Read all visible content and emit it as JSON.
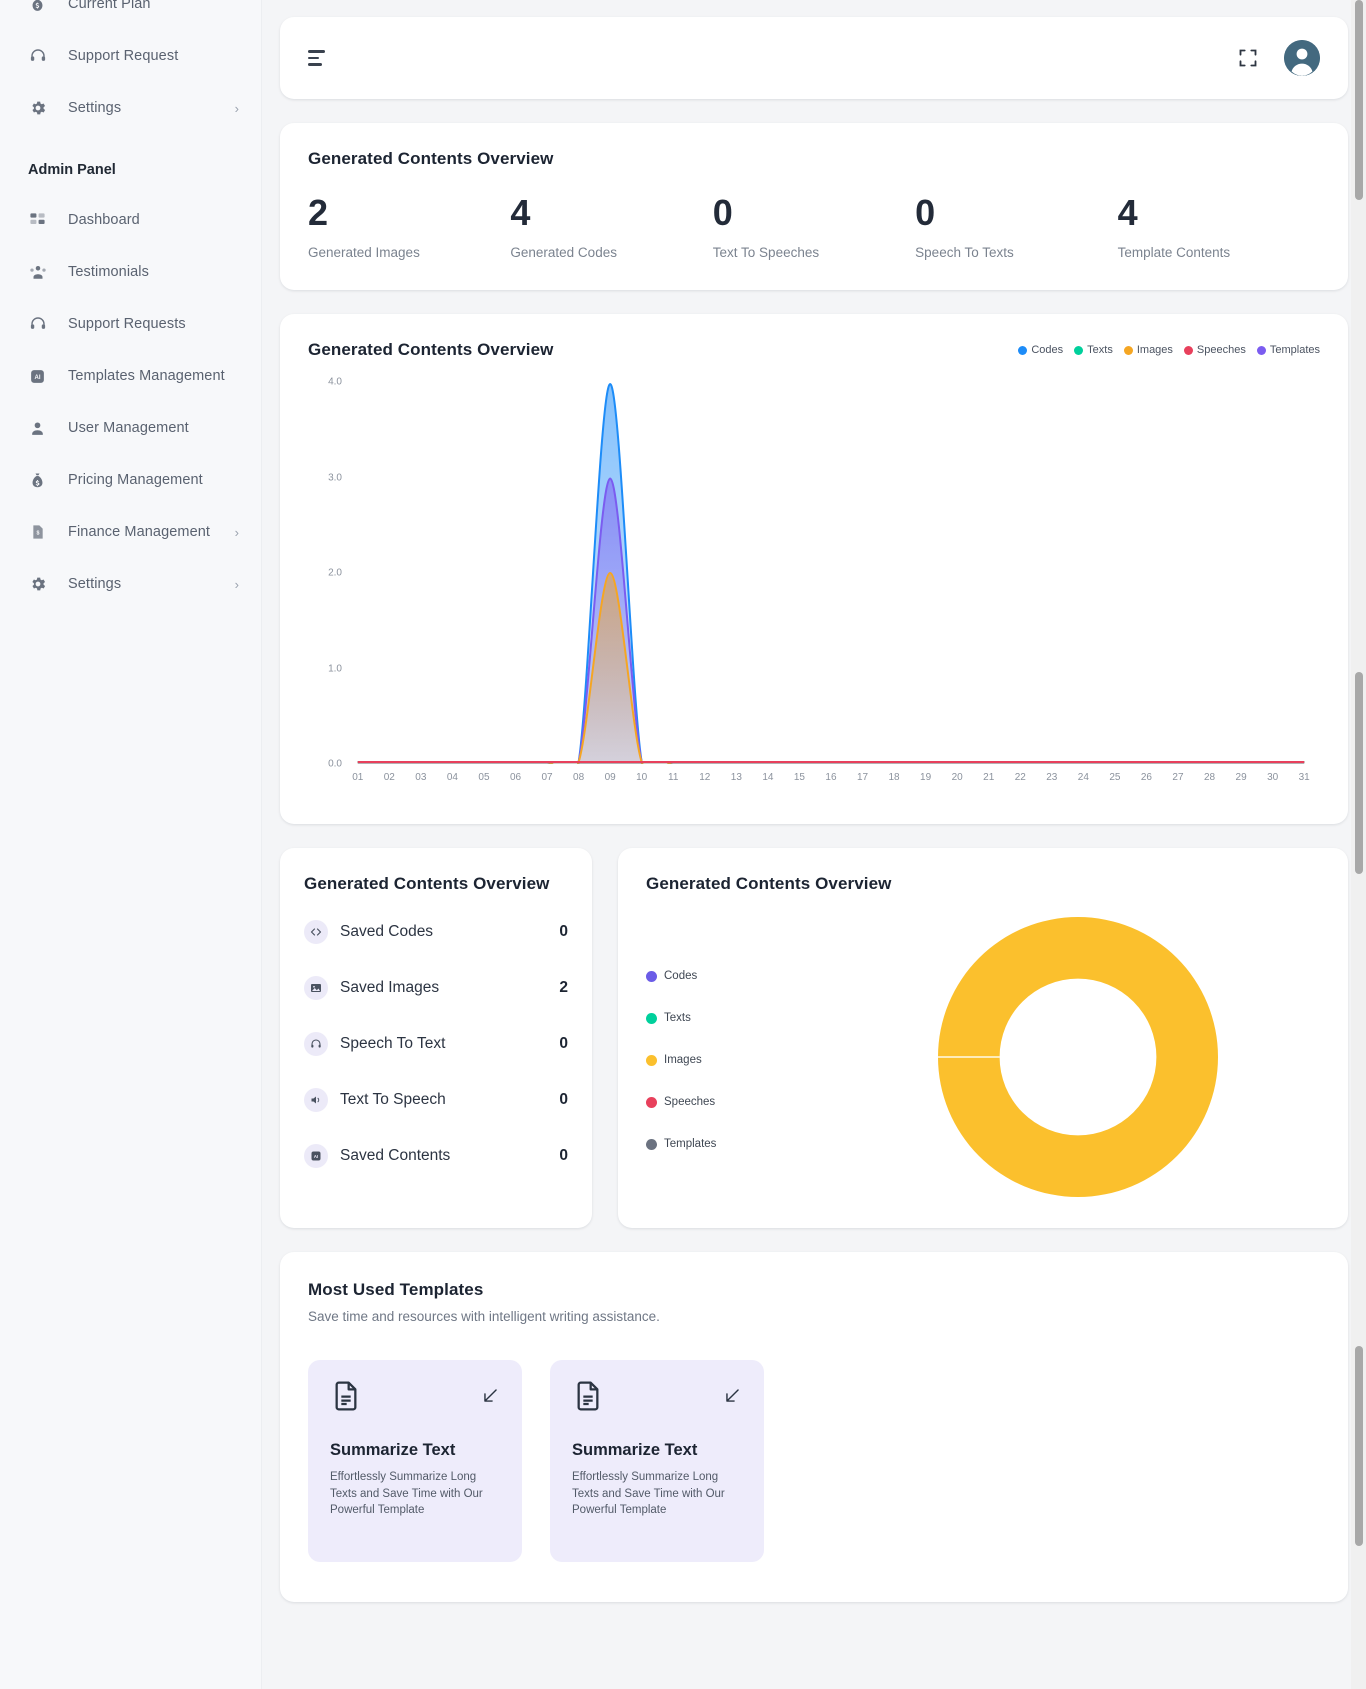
{
  "sidebar": {
    "top_items": [
      {
        "label": "Current Plan",
        "icon": "wallet-icon",
        "chevron": false
      },
      {
        "label": "Support Request",
        "icon": "headset-icon",
        "chevron": false
      },
      {
        "label": "Settings",
        "icon": "gear-icon",
        "chevron": true
      }
    ],
    "section_label": "Admin Panel",
    "admin_items": [
      {
        "label": "Dashboard",
        "icon": "grid-icon",
        "chevron": false
      },
      {
        "label": "Testimonials",
        "icon": "people-icon",
        "chevron": false
      },
      {
        "label": "Support Requests",
        "icon": "headset-icon",
        "chevron": false
      },
      {
        "label": "Templates Management",
        "icon": "ai-chip-icon",
        "chevron": false
      },
      {
        "label": "User Management",
        "icon": "user-icon",
        "chevron": false
      },
      {
        "label": "Pricing Management",
        "icon": "money-bag-icon",
        "chevron": false
      },
      {
        "label": "Finance Management",
        "icon": "invoice-icon",
        "chevron": true
      },
      {
        "label": "Settings",
        "icon": "gear-icon",
        "chevron": true
      }
    ],
    "chevron_glyph": "›"
  },
  "topbar": {
    "menu_icon": "hamburger-icon",
    "fullscreen_icon": "fullscreen-icon",
    "avatar_icon": "user-avatar"
  },
  "stats": {
    "title": "Generated Contents Overview",
    "items": [
      {
        "value": "2",
        "label": "Generated Images"
      },
      {
        "value": "4",
        "label": "Generated Codes"
      },
      {
        "value": "0",
        "label": "Text To Speeches"
      },
      {
        "value": "0",
        "label": "Speech To Texts"
      },
      {
        "value": "4",
        "label": "Template Contents"
      }
    ]
  },
  "line_card": {
    "title": "Generated Contents Overview"
  },
  "list_card": {
    "title": "Generated Contents Overview",
    "rows": [
      {
        "label": "Saved Codes",
        "value": "0",
        "icon": "code-icon"
      },
      {
        "label": "Saved Images",
        "value": "2",
        "icon": "image-icon"
      },
      {
        "label": "Speech To Text",
        "value": "0",
        "icon": "headphones-icon"
      },
      {
        "label": "Text To Speech",
        "value": "0",
        "icon": "speaker-icon"
      },
      {
        "label": "Saved Contents",
        "value": "0",
        "icon": "ai-chip-icon"
      }
    ]
  },
  "donut_card": {
    "title": "Generated Contents Overview"
  },
  "templates": {
    "title": "Most Used Templates",
    "subtitle": "Save time and resources with intelligent writing assistance.",
    "items": [
      {
        "name": "Summarize Text",
        "desc": "Effortlessly Summarize Long Texts and Save Time with Our Powerful Template",
        "icon": "document-icon",
        "action_icon": "arrow-down-left-icon"
      },
      {
        "name": "Summarize Text",
        "desc": "Effortlessly Summarize Long Texts and Save Time with Our Powerful Template",
        "icon": "document-icon",
        "action_icon": "arrow-down-left-icon"
      }
    ]
  },
  "chart_data": [
    {
      "id": "generated-contents-line",
      "type": "area",
      "title": "Generated Contents Overview",
      "xlabel": "",
      "ylabel": "",
      "grid": false,
      "legend_position": "top-right",
      "x": [
        "01",
        "02",
        "03",
        "04",
        "05",
        "06",
        "07",
        "08",
        "09",
        "10",
        "11",
        "12",
        "13",
        "14",
        "15",
        "16",
        "17",
        "18",
        "19",
        "20",
        "21",
        "22",
        "23",
        "24",
        "25",
        "26",
        "27",
        "28",
        "29",
        "30",
        "31"
      ],
      "ylim": [
        0,
        4
      ],
      "yticks": [
        "0.0",
        "1.0",
        "2.0",
        "3.0",
        "4.0"
      ],
      "series": [
        {
          "name": "Codes",
          "color": "#1d8cf8",
          "values": [
            0,
            0,
            0,
            0,
            0,
            0,
            0,
            0,
            4,
            0,
            0,
            0,
            0,
            0,
            0,
            0,
            0,
            0,
            0,
            0,
            0,
            0,
            0,
            0,
            0,
            0,
            0,
            0,
            0,
            0,
            0
          ]
        },
        {
          "name": "Texts",
          "color": "#00d09c",
          "values": [
            0,
            0,
            0,
            0,
            0,
            0,
            0,
            0,
            0,
            0,
            0,
            0,
            0,
            0,
            0,
            0,
            0,
            0,
            0,
            0,
            0,
            0,
            0,
            0,
            0,
            0,
            0,
            0,
            0,
            0,
            0
          ]
        },
        {
          "name": "Images",
          "color": "#f5a623",
          "values": [
            0,
            0,
            0,
            0,
            0,
            0,
            0,
            0,
            2,
            0,
            0,
            0,
            0,
            0,
            0,
            0,
            0,
            0,
            0,
            0,
            0,
            0,
            0,
            0,
            0,
            0,
            0,
            0,
            0,
            0,
            0
          ]
        },
        {
          "name": "Speeches",
          "color": "#e8405c",
          "values": [
            0,
            0,
            0,
            0,
            0,
            0,
            0,
            0,
            0,
            0,
            0,
            0,
            0,
            0,
            0,
            0,
            0,
            0,
            0,
            0,
            0,
            0,
            0,
            0,
            0,
            0,
            0,
            0,
            0,
            0,
            0
          ]
        },
        {
          "name": "Templates",
          "color": "#7b5cf0",
          "values": [
            0,
            0,
            0,
            0,
            0,
            0,
            0,
            0,
            3,
            0,
            0,
            0,
            0,
            0,
            0,
            0,
            0,
            0,
            0,
            0,
            0,
            0,
            0,
            0,
            0,
            0,
            0,
            0,
            0,
            0,
            0
          ]
        }
      ]
    },
    {
      "id": "generated-contents-donut",
      "type": "pie",
      "title": "Generated Contents Overview",
      "legend_position": "left",
      "hole": 0.56,
      "labels": [
        "Codes",
        "Texts",
        "Images",
        "Speeches",
        "Templates"
      ],
      "values": [
        0,
        0,
        100,
        0,
        0
      ],
      "colors": [
        "#6b5ce7",
        "#00d09c",
        "#fbc02d",
        "#e8405c",
        "#6b7280"
      ]
    }
  ]
}
